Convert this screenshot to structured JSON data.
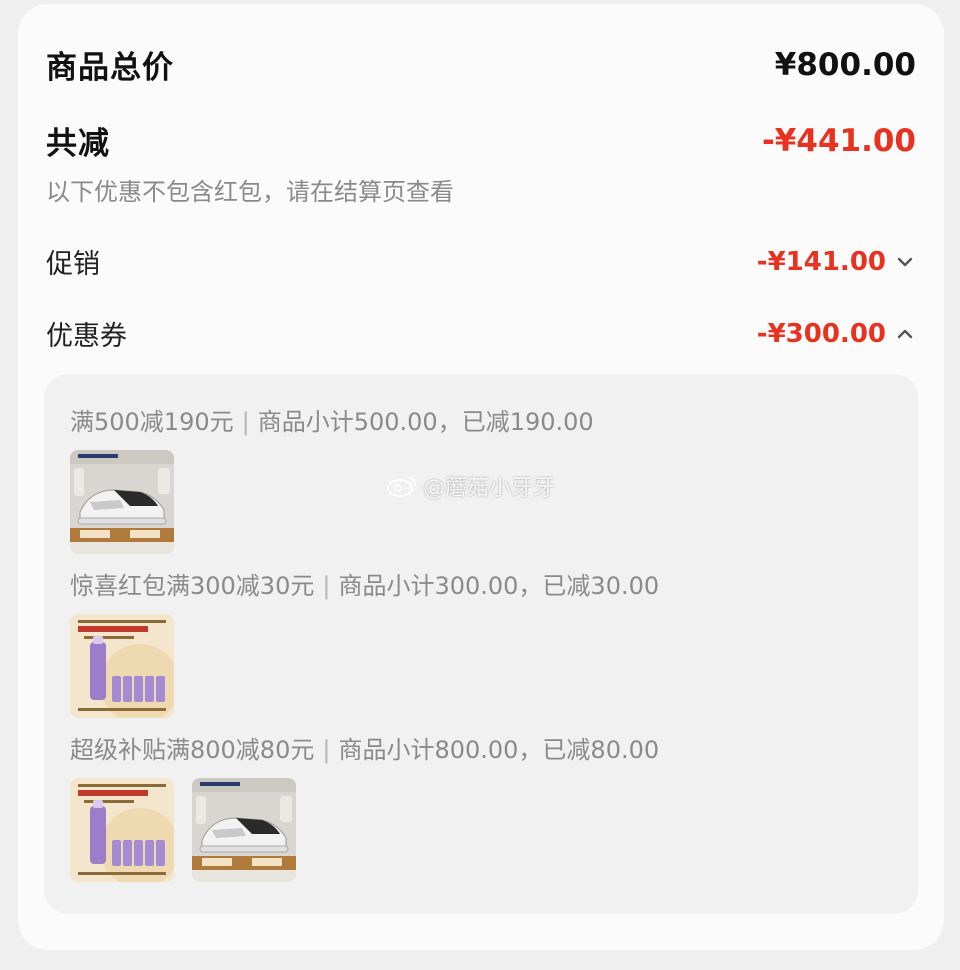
{
  "summary": {
    "total_label": "商品总价",
    "total_value": "¥800.00",
    "reduce_label": "共减",
    "reduce_value": "-¥441.00",
    "note": "以下优惠不包含红包，请在结算页查看"
  },
  "promo": {
    "label": "促销",
    "value": "-¥141.00",
    "expanded": false
  },
  "coupon": {
    "label": "优惠券",
    "value": "-¥300.00",
    "expanded": true
  },
  "coupons": [
    {
      "title": "满500减190元",
      "detail": "商品小计500.00，已减190.00",
      "products": [
        "sneaker"
      ]
    },
    {
      "title": "惊喜红包满300减30元",
      "detail": "商品小计300.00，已减30.00",
      "products": [
        "serum"
      ]
    },
    {
      "title": "超级补贴满800减80元",
      "detail": "商品小计800.00，已减80.00",
      "products": [
        "serum",
        "sneaker"
      ]
    }
  ],
  "watermark": "@蘑菇小牙牙",
  "colors": {
    "accent_red": "#e8321f",
    "text_primary": "#111111",
    "text_secondary": "#8a8a8a",
    "card_bg": "#fbfbfb",
    "panel_bg": "#f1f1f1"
  }
}
